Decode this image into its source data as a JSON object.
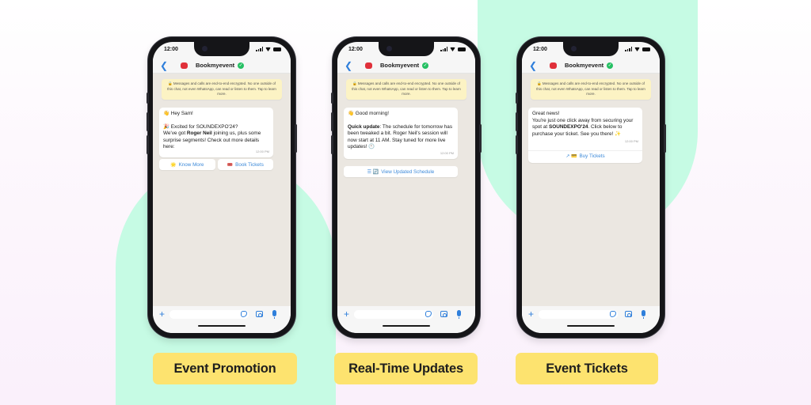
{
  "colors": {
    "mint": "#c6fbe4",
    "label_yellow": "#fde36f",
    "link_blue": "#3d8ad9",
    "verified_green": "#25c063",
    "encryption_banner": "#fcf3c4",
    "chat_background": "#ebe7e1"
  },
  "phones": [
    {
      "status_time": "12:00",
      "contact_name": "Bookmyevent",
      "back_icon": "chevron-left-icon",
      "verified_icon": "check-badge-icon",
      "encryption_notice": "🔒 Messages and calls are end-to-end encrypted. No one outside of this chat, not even WhatsApp, can read or listen to them. Tap to learn more.",
      "message": {
        "line1": "👋 Hey Sam!",
        "line2": "🎉 Excited for SOUNDEXPO'24?",
        "line3_pre": "We've got ",
        "line3_bold": "Roger Neil",
        "line3_post": " joining us, plus some surprise segments! Check out more details here:",
        "timestamp": "12:00 PM"
      },
      "buttons": [
        {
          "icon": "🌟",
          "label": "Know More"
        },
        {
          "icon": "🎟️",
          "label": "Book Tickets"
        }
      ],
      "caption": "Event Promotion"
    },
    {
      "status_time": "12:00",
      "contact_name": "Bookmyevent",
      "back_icon": "chevron-left-icon",
      "verified_icon": "check-badge-icon",
      "encryption_notice": "🔒 Messages and calls are end-to-end encrypted. No one outside of this chat, not even WhatsApp, can read or listen to them. Tap to learn more.",
      "message": {
        "line1": "👋 Good morning!",
        "line2_bold": "Quick update",
        "line2_post": ": The schedule for tomorrow has been tweaked a bit. Roger Neil's session will now start at 11 AM. Stay tuned for more live updates! 🕚",
        "timestamp": "12:00 PM"
      },
      "buttons": [
        {
          "icon": "☰ 🔄",
          "label": "View Updated Schedule"
        }
      ],
      "caption": "Real-Time Updates"
    },
    {
      "status_time": "12:00",
      "contact_name": "Bookmyevent",
      "back_icon": "chevron-left-icon",
      "verified_icon": "check-badge-icon",
      "encryption_notice": "🔒 Messages and calls are end-to-end encrypted. No one outside of this chat, not even WhatsApp, can read or listen to them. Tap to learn more.",
      "message": {
        "line1": "Great news!",
        "line2_pre": "You're just one click away from securing your spot at ",
        "line2_bold": "SOUNDEXPO'24",
        "line2_post": ". Click below to purchase your ticket. See you there! ✨",
        "timestamp": "12:00 PM"
      },
      "buttons": [
        {
          "icon": "↗ 💳",
          "label": "Buy Tickets"
        }
      ],
      "caption": "Event Tickets"
    }
  ]
}
